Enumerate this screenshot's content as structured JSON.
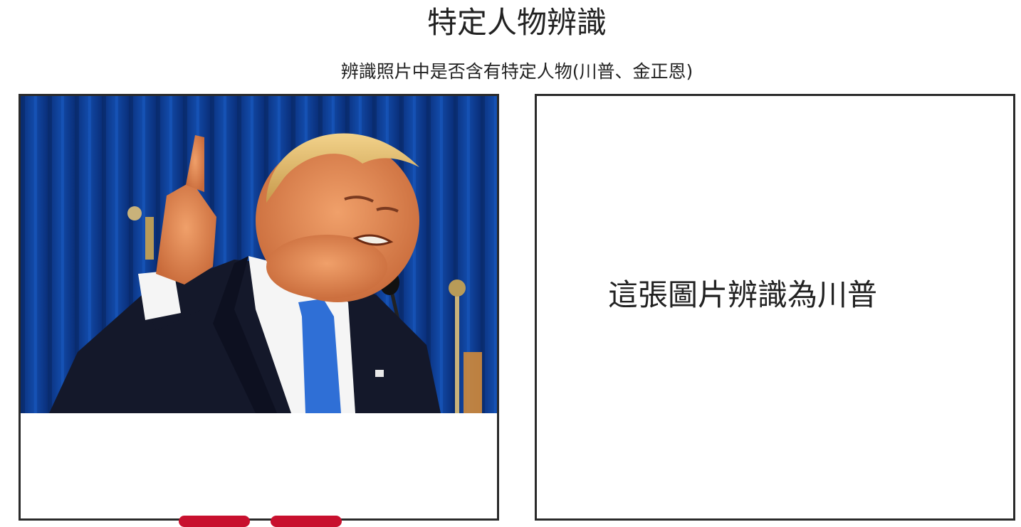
{
  "header": {
    "title": "特定人物辨識",
    "subtitle": "辨識照片中是否含有特定人物(川普、金正恩)"
  },
  "result": {
    "text": "這張圖片辨識為川普"
  },
  "colors": {
    "panel_border": "#2a2a2a",
    "curtain_blue": "#0f3f9a",
    "tie_blue": "#2f6fd6",
    "button_red": "#c8102e"
  }
}
